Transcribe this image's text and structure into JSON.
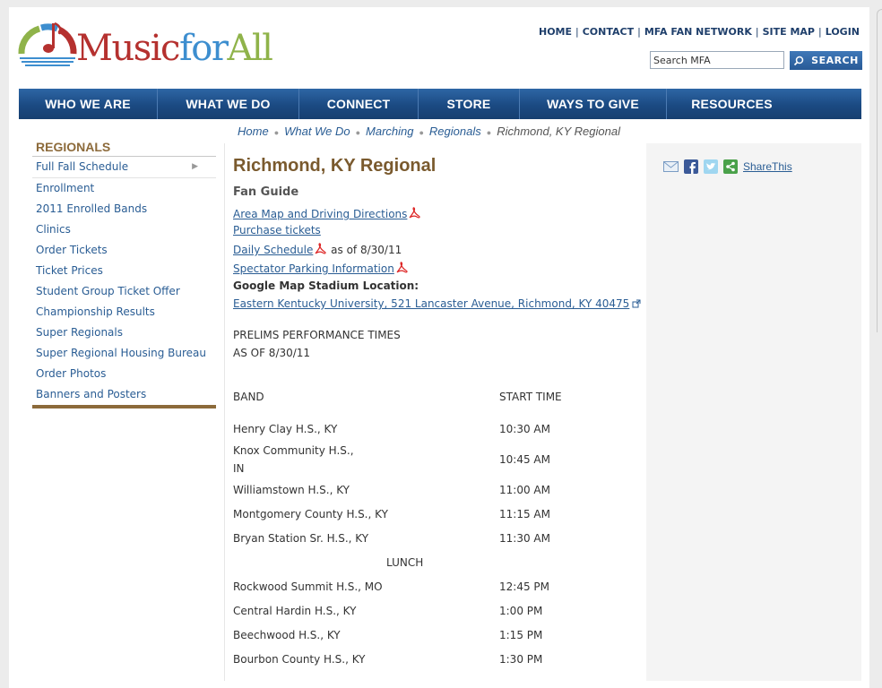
{
  "logo": {
    "part1": "Music",
    "part2": "for",
    "part3": "All",
    "colors": {
      "music": "#b5312f",
      "for": "#3d8ecf",
      "all": "#8fb34a"
    }
  },
  "toplinks": [
    "HOME",
    "CONTACT",
    "MFA FAN NETWORK",
    "SITE MAP",
    "LOGIN"
  ],
  "search": {
    "placeholder": "Search MFA",
    "button": "SEARCH"
  },
  "nav": [
    "WHO WE ARE",
    "WHAT WE DO",
    "CONNECT",
    "STORE",
    "WAYS TO GIVE",
    "RESOURCES"
  ],
  "breadcrumb": [
    "Home",
    "What We Do",
    "Marching",
    "Regionals",
    "Richmond, KY Regional"
  ],
  "sidebar": {
    "title": "REGIONALS",
    "items": [
      "Full Fall Schedule",
      "Enrollment",
      "2011 Enrolled Bands",
      "Clinics",
      "Order Tickets",
      "Ticket Prices",
      "Student Group Ticket Offer",
      "Championship Results",
      "Super Regionals",
      "Super Regional Housing Bureau",
      "Order Photos",
      "Banners and Posters"
    ]
  },
  "main": {
    "title": "Richmond, KY Regional",
    "fan_guide": "Fan Guide",
    "links": {
      "area_map": "Area Map and Driving Directions",
      "purchase": "Purchase tickets",
      "schedule": "Daily Schedule",
      "schedule_suffix": "as of 8/30/11",
      "parking": "Spectator Parking Information"
    },
    "google_label": "Google Map Stadium Location:",
    "address": "Eastern Kentucky University, 521 Lancaster Avenue, Richmond, KY 40475",
    "prelims_title": "PRELIMS PERFORMANCE TIMES",
    "prelims_asof": "AS OF 8/30/11",
    "table": {
      "headers": [
        "BAND",
        "START TIME"
      ],
      "rows": [
        {
          "band": "Henry Clay H.S., KY",
          "time": "10:30 AM"
        },
        {
          "band": "Knox Community H.S., IN",
          "time": "10:45 AM"
        },
        {
          "band": "Williamstown H.S., KY",
          "time": "11:00 AM"
        },
        {
          "band": "Montgomery County H.S., KY",
          "time": "11:15 AM"
        },
        {
          "band": "Bryan Station Sr. H.S., KY",
          "time": "11:30 AM"
        },
        {
          "band": "Rockwood Summit H.S., MO",
          "time": "12:45 PM"
        },
        {
          "band": "Central Hardin H.S., KY",
          "time": "1:00 PM"
        },
        {
          "band": "Beechwood H.S., KY",
          "time": "1:15 PM"
        },
        {
          "band": "Bourbon County H.S., KY",
          "time": "1:30 PM"
        }
      ],
      "lunch": "LUNCH"
    }
  },
  "share": {
    "label": "ShareThis"
  }
}
